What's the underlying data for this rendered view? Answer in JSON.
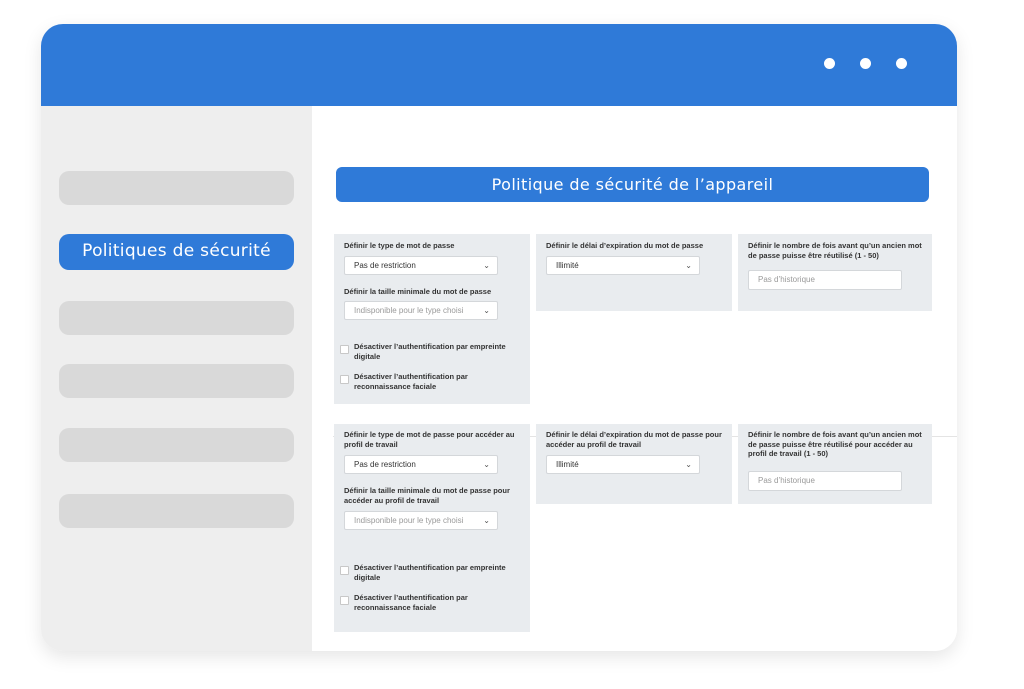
{
  "sidebar": {
    "active_label": "Politiques de sécurité"
  },
  "main": {
    "title": "Politique de sécurité de l’appareil"
  },
  "device_section": {
    "password_type_label": "Définir le type de mot de passe",
    "password_type_value": "Pas de restriction",
    "min_length_label": "Définir la taille minimale du mot de passe",
    "min_length_value": "Indisponible pour le type choisi",
    "disable_fingerprint_label": "Désactiver l’authentification par empreinte digitale",
    "disable_face_label": "Désactiver l’authentification par reconnaissance faciale",
    "expiration_label": "Définir le délai d’expiration du mot de passe",
    "expiration_value": "Illimité",
    "history_label": "Définir le nombre de fois avant qu’un ancien mot de passe puisse être réutilisé (1 - 50)",
    "history_placeholder": "Pas d’historique"
  },
  "work_profile_section": {
    "password_type_label": "Définir le type de mot de passe pour accéder au profil de travail",
    "password_type_value": "Pas de restriction",
    "min_length_label": "Définir la taille minimale du mot de passe pour accéder au profil de travail",
    "min_length_value": "Indisponible pour le type choisi",
    "disable_fingerprint_label": "Désactiver l’authentification par empreinte digitale",
    "disable_face_label": "Désactiver l’authentification par reconnaissance faciale",
    "expiration_label": "Définir le délai d’expiration du mot de passe pour accéder au profil de travail",
    "expiration_value": "Illimité",
    "history_label": "Définir le nombre de fois avant qu’un ancien mot de passe puisse être réutilisé pour accéder au profil de travail (1 - 50)",
    "history_placeholder": "Pas d’historique"
  },
  "icons": {
    "dropdown": "chevron-down-icon",
    "window_menu": "three-dots-icon"
  },
  "colors": {
    "accent": "#2f7ad8",
    "card_background": "#e9ecef",
    "sidebar_background": "#eeeeee",
    "placeholder_pill": "#d9d9d9"
  }
}
